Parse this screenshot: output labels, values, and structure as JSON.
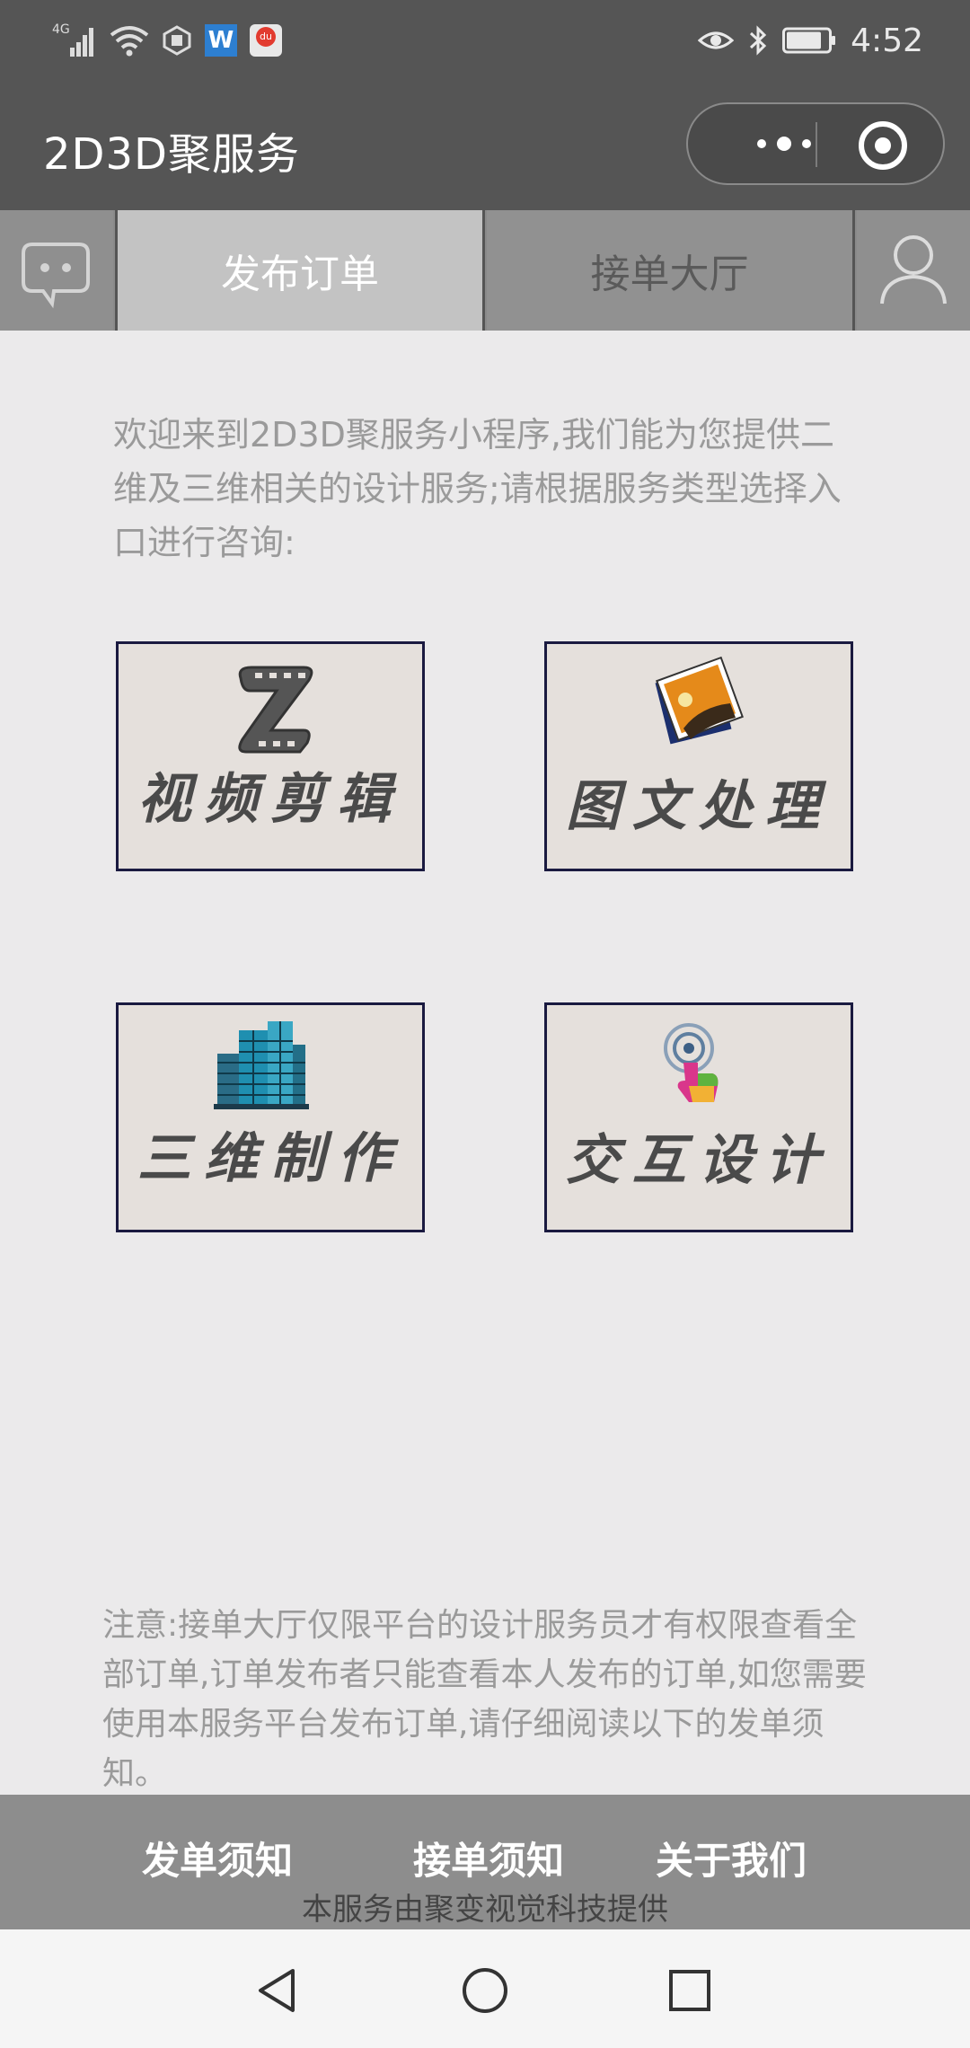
{
  "status_bar": {
    "network": "4G",
    "time": "4:52",
    "app_badge_w": "W",
    "app_badge_du": "du"
  },
  "title_bar": {
    "title": "2D3D聚服务"
  },
  "tabs": {
    "publish": "发布订单",
    "hall": "接单大厅"
  },
  "intro": "欢迎来到2D3D聚服务小程序,我们能为您提供二维及三维相关的设计服务;请根据服务类型选择入口进行咨询:",
  "services": [
    {
      "label": "视频剪辑",
      "icon": "film-strip-icon"
    },
    {
      "label": "图文处理",
      "icon": "photo-icon"
    },
    {
      "label": "三维制作",
      "icon": "buildings-icon"
    },
    {
      "label": "交互设计",
      "icon": "touch-icon"
    }
  ],
  "notice": "注意:接单大厅仅限平台的设计服务员才有权限查看全部订单,订单发布者只能查看本人发布的订单,如您需要使用本服务平台发布订单,请仔细阅读以下的发单须知。",
  "footer": {
    "links": [
      "发单须知",
      "接单须知",
      "关于我们"
    ],
    "credit": "本服务由聚变视觉科技提供"
  },
  "colors": {
    "bar": "#555555",
    "tab_active": "#c3c3c3",
    "card_bg": "#e5e0dc",
    "card_border": "#1a1a40",
    "footer_bg": "#8d8d8d"
  }
}
